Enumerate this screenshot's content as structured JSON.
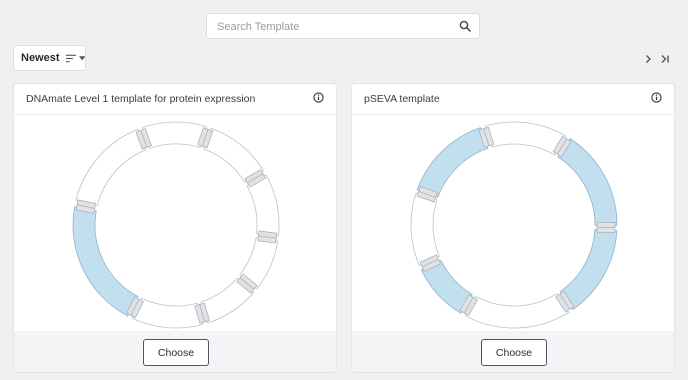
{
  "search": {
    "placeholder": "Search Template",
    "value": "",
    "icon": "search-icon"
  },
  "sort": {
    "label": "Newest",
    "icon": "sort-lines-icon",
    "caret_icon": "caret-down-icon"
  },
  "pagination": {
    "next_icon": "chevron-right-icon",
    "last_icon": "last-page-icon"
  },
  "colors": {
    "feature_fill": "#c2dff0",
    "feature_stroke": "#8fb4cc",
    "segment_fill": "#ffffff",
    "segment_stroke": "#bfc1c6",
    "connector_fill": "#e1e2e5",
    "connector_stroke": "#a9abb0",
    "button_border": "#505360"
  },
  "templates": [
    {
      "title": "DNAmate Level 1 template for protein expression",
      "info_icon": "info-icon",
      "action_label": "Choose",
      "map_segments": [
        {
          "start": -76,
          "end": -22,
          "type": "plain"
        },
        {
          "start": -19,
          "end": 17,
          "type": "plain"
        },
        {
          "start": 20,
          "end": 58,
          "type": "plain"
        },
        {
          "start": 61,
          "end": 96,
          "type": "plain"
        },
        {
          "start": 99,
          "end": 128,
          "type": "plain"
        },
        {
          "start": 131,
          "end": 162,
          "type": "plain"
        },
        {
          "start": 165,
          "end": 205,
          "type": "plain"
        },
        {
          "start": 208,
          "end": 280,
          "type": "feature"
        }
      ]
    },
    {
      "title": "pSEVA template",
      "info_icon": "info-icon",
      "action_label": "Choose",
      "map_segments": [
        {
          "start": -70,
          "end": -19,
          "type": "feature"
        },
        {
          "start": -16,
          "end": 30,
          "type": "plain"
        },
        {
          "start": 33,
          "end": 90,
          "type": "feature"
        },
        {
          "start": 93,
          "end": 145,
          "type": "feature"
        },
        {
          "start": 148,
          "end": 208,
          "type": "plain"
        },
        {
          "start": 211,
          "end": 244,
          "type": "feature"
        },
        {
          "start": 247,
          "end": 288,
          "type": "plain"
        }
      ]
    }
  ]
}
